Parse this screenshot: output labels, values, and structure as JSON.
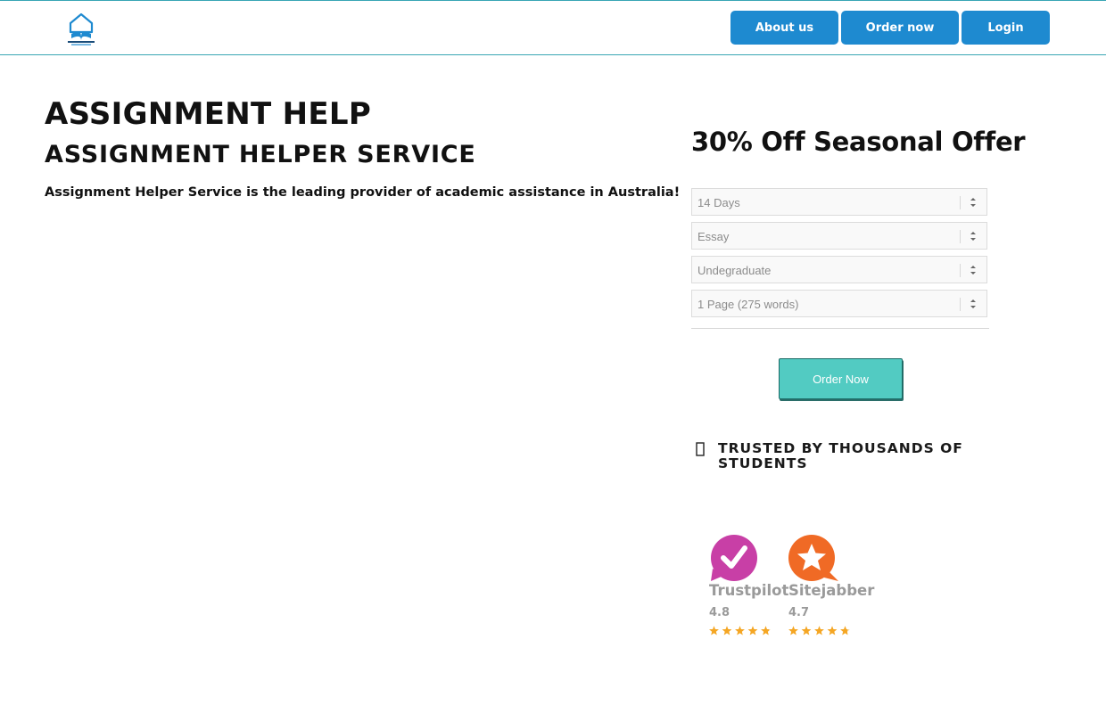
{
  "nav": {
    "about_label": "About us",
    "order_label": "Order now",
    "login_label": "Login",
    "logo_icon": "assignment-help-logo"
  },
  "hero": {
    "title": "ASSIGNMENT HELP",
    "subtitle": "ASSIGNMENT HELPER SERVICE",
    "lead": "Assignment Helper Service is the leading provider of academic assistance in Australia!"
  },
  "order_form": {
    "heading": "30% Off Seasonal Offer",
    "deadline": "14 Days",
    "paper_type": "Essay",
    "level": "Undegraduate",
    "pages": "1 Page (275 words)",
    "submit_label": "Order Now"
  },
  "trust": {
    "heading": "TRUSTED BY THOUSANDS OF STUDENTS",
    "icon": "thumbs-up-icon",
    "reviews": [
      {
        "name": "Trustpilot",
        "score": "4.8",
        "rating": 4.8,
        "color": "#c83fa6"
      },
      {
        "name": "Sitejabber",
        "score": "4.7",
        "rating": 4.7,
        "color": "#f06a25"
      }
    ]
  },
  "colors": {
    "accent_blue": "#1e8ad0",
    "teal_button": "#52cbc2",
    "header_border": "#38a6b4",
    "star": "#f5a623"
  }
}
